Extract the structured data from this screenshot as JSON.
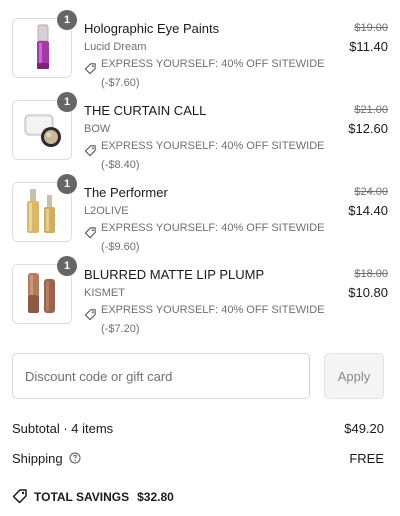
{
  "items": [
    {
      "quantity": "1",
      "name": "Holographic Eye Paints",
      "brand": "Lucid Dream",
      "discount_label": "EXPRESS YOURSELF: 40% OFF SITEWIDE",
      "discount_amount": "(-$7.60)",
      "original_price": "$19.00",
      "price": "$11.40",
      "image": "purple-eye-paint-tube"
    },
    {
      "quantity": "1",
      "name": "THE CURTAIN CALL",
      "brand": "BOW",
      "discount_label": "EXPRESS YOURSELF: 40% OFF SITEWIDE",
      "discount_amount": "(-$8.40)",
      "original_price": "$21.00",
      "price": "$12.60",
      "image": "compact-jar"
    },
    {
      "quantity": "1",
      "name": "The Performer",
      "brand": "L2OLIVE",
      "discount_label": "EXPRESS YOURSELF: 40% OFF SITEWIDE",
      "discount_amount": "(-$9.60)",
      "original_price": "$24.00",
      "price": "$14.40",
      "image": "gold-serum-bottles"
    },
    {
      "quantity": "1",
      "name": "BLURRED MATTE LIP PLUMP",
      "brand": "KISMET",
      "discount_label": "EXPRESS YOURSELF: 40% OFF SITEWIDE",
      "discount_amount": "(-$7.20)",
      "original_price": "$18.00",
      "price": "$10.80",
      "image": "brown-lip-tube"
    }
  ],
  "discount_code": {
    "placeholder": "Discount code or gift card",
    "value": "",
    "apply_label": "Apply"
  },
  "summary": {
    "subtotal_label": "Subtotal · 4 items",
    "subtotal_value": "$49.20",
    "shipping_label": "Shipping",
    "shipping_value": "FREE",
    "total_savings_label": "TOTAL SAVINGS",
    "total_savings_value": "$32.80"
  },
  "icons": {
    "discount": "tag-icon",
    "help": "question-circle-icon"
  },
  "colors": {
    "quantity_badge": "#666666",
    "muted_text": "#707070",
    "apply_disabled": "#f4f4f4"
  }
}
